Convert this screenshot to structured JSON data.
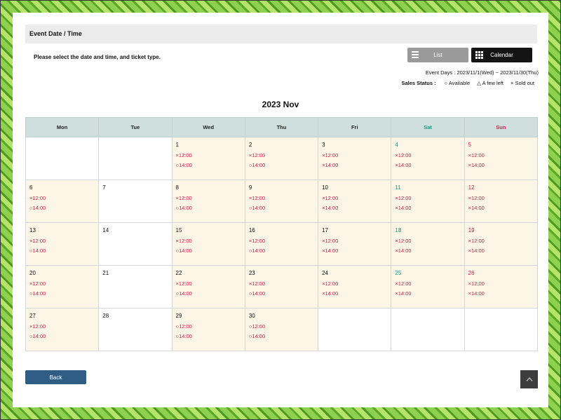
{
  "section": {
    "title": "Event Date / Time"
  },
  "instruction": "Please select the date and time, and ticket type.",
  "view_toggle": {
    "list_label": "List",
    "calendar_label": "Calendar"
  },
  "event_days": "Event Days : 2023/11/1(Wed) ~ 2023/11/30(Thu)",
  "sales_status": {
    "label": "Sales Status :",
    "available": "○ Available",
    "few_left": "△ A few left",
    "sold_out": "× Sold out"
  },
  "colors": {
    "saturday": "#1e9a82",
    "sunday": "#d2204a",
    "event_bg": "#fdf6e6",
    "header_bg": "#cfdfdd"
  },
  "calendar": {
    "month_title": "2023 Nov",
    "weekdays": [
      "Mon",
      "Tue",
      "Wed",
      "Thu",
      "Fri",
      "Sat",
      "Sun"
    ],
    "weeks": [
      [
        {
          "day": "",
          "slots": []
        },
        {
          "day": "",
          "slots": []
        },
        {
          "day": "1",
          "slots": [
            "×12:00",
            "○14:00"
          ]
        },
        {
          "day": "2",
          "slots": [
            "×12:00",
            "○14:00"
          ]
        },
        {
          "day": "3",
          "slots": [
            "×12:00",
            "×14:00"
          ]
        },
        {
          "day": "4",
          "slots": [
            "×12:00",
            "×14:00"
          ]
        },
        {
          "day": "5",
          "slots": [
            "×12:00",
            "×14:00"
          ]
        }
      ],
      [
        {
          "day": "6",
          "slots": [
            "×12:00",
            "○14:00"
          ]
        },
        {
          "day": "7",
          "slots": []
        },
        {
          "day": "8",
          "slots": [
            "×12:00",
            "○14:00"
          ]
        },
        {
          "day": "9",
          "slots": [
            "×12:00",
            "○14:00"
          ]
        },
        {
          "day": "10",
          "slots": [
            "×12:00",
            "×14:00"
          ]
        },
        {
          "day": "11",
          "slots": [
            "×12:00",
            "×14:00"
          ]
        },
        {
          "day": "12",
          "slots": [
            "×12:00",
            "×14:00"
          ]
        }
      ],
      [
        {
          "day": "13",
          "slots": [
            "×12:00",
            "○14:00"
          ]
        },
        {
          "day": "14",
          "slots": []
        },
        {
          "day": "15",
          "slots": [
            "×12:00",
            "○14:00"
          ]
        },
        {
          "day": "16",
          "slots": [
            "×12:00",
            "○14:00"
          ]
        },
        {
          "day": "17",
          "slots": [
            "×12:00",
            "×14:00"
          ]
        },
        {
          "day": "18",
          "slots": [
            "×12:00",
            "×14:00"
          ]
        },
        {
          "day": "19",
          "slots": [
            "×12:00",
            "×14:00"
          ]
        }
      ],
      [
        {
          "day": "20",
          "slots": [
            "×12:00",
            "○14:00"
          ]
        },
        {
          "day": "21",
          "slots": []
        },
        {
          "day": "22",
          "slots": [
            "×12:00",
            "○14:00"
          ]
        },
        {
          "day": "23",
          "slots": [
            "×12:00",
            "○14:00"
          ]
        },
        {
          "day": "24",
          "slots": [
            "×12:00",
            "×14:00"
          ]
        },
        {
          "day": "25",
          "slots": [
            "×12:00",
            "×14:00"
          ]
        },
        {
          "day": "26",
          "slots": [
            "×12:00",
            "×14:00"
          ]
        }
      ],
      [
        {
          "day": "27",
          "slots": [
            "×12:00",
            "○14:00"
          ]
        },
        {
          "day": "28",
          "slots": []
        },
        {
          "day": "29",
          "slots": [
            "○12:00",
            "○14:00"
          ]
        },
        {
          "day": "30",
          "slots": [
            "○12:00",
            "○14:00"
          ]
        },
        {
          "day": "",
          "slots": []
        },
        {
          "day": "",
          "slots": []
        },
        {
          "day": "",
          "slots": []
        }
      ]
    ]
  },
  "back_button": {
    "label": "Back"
  },
  "icons": {
    "list": "list-icon",
    "calendar": "grid-calendar-icon",
    "scroll_top": "chevron-up-icon"
  }
}
